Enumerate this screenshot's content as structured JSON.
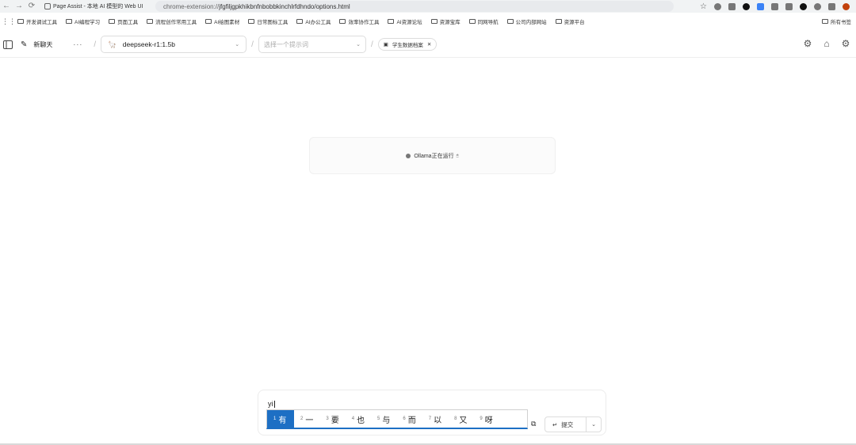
{
  "browser": {
    "tab_title": "Page Assist - 本地 AI 模型的 Web UI",
    "url_scheme": "chrome-extension://",
    "url_rest": "jfgfiljgpkhikbnfnbobbkinchlrfdhndo/options.html"
  },
  "bookmarks": {
    "items": [
      "开发调试工具",
      "AI编程学习",
      "页面工具",
      "流程创作常用工具",
      "AI绘图素材",
      "日常图标工具",
      "AI办公工具",
      "效率协作工具",
      "AI资源论坛",
      "资源宝库",
      "同网导航",
      "公司内部网站",
      "资源平台"
    ],
    "right_item": "所有书签"
  },
  "header": {
    "new_chat_label": "新聊天",
    "more_label": "···",
    "model_value": "deepseek-r1:1.5b",
    "prompt_placeholder": "选择一个提示词",
    "knowledge_chip": "学生数据档案"
  },
  "status": {
    "text": "Ollama正在运行",
    "note": "🖱"
  },
  "composer": {
    "typed_text": "yi"
  },
  "ime": {
    "candidates": [
      {
        "num": "1",
        "char": "有"
      },
      {
        "num": "2",
        "char": "一"
      },
      {
        "num": "3",
        "char": "要"
      },
      {
        "num": "4",
        "char": "也"
      },
      {
        "num": "5",
        "char": "与"
      },
      {
        "num": "6",
        "char": "而"
      },
      {
        "num": "7",
        "char": "以"
      },
      {
        "num": "8",
        "char": "又"
      },
      {
        "num": "9",
        "char": "呀"
      }
    ]
  },
  "submit": {
    "label": "提交"
  }
}
